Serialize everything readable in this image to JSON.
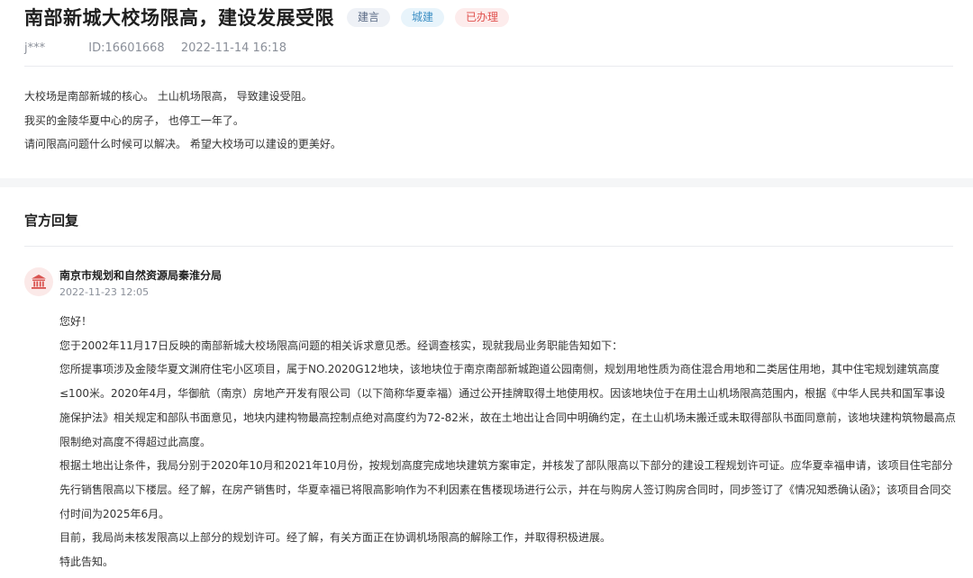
{
  "question": {
    "title": "南部新城大校场限高，建设发展受限",
    "tags": {
      "advice": "建言",
      "category": "城建",
      "status": "已办理"
    },
    "user": "j***",
    "id_label": "ID:16601668",
    "datetime": "2022-11-14 16:18",
    "body": [
      "大校场是南部新城的核心。 土山机场限高， 导致建设受阻。",
      "我买的金陵华夏中心的房子， 也停工一年了。",
      "请问限高问题什么时候可以解决。 希望大校场可以建设的更美好。"
    ]
  },
  "reply": {
    "section_title": "官方回复",
    "org_icon": "government-building-icon",
    "org_name": "南京市规划和自然资源局秦淮分局",
    "datetime": "2022-11-23 12:05",
    "paragraphs": [
      "您好！",
      "您于2002年11月17日反映的南部新城大校场限高问题的相关诉求意见悉。经调查核实，现就我局业务职能告知如下：",
      "您所提事项涉及金陵华夏文渊府住宅小区项目，属于NO.2020G12地块，该地块位于南京南部新城跑道公园南侧，规划用地性质为商住混合用地和二类居住用地，其中住宅规划建筑高度≤100米。2020年4月，华御航（南京）房地产开发有限公司（以下简称华夏幸福）通过公开挂牌取得土地使用权。因该地块位于在用土山机场限高范围内，根据《中华人民共和国军事设施保护法》相关规定和部队书面意见，地块内建构物最高控制点绝对高度约为72-82米，故在土地出让合同中明确约定，在土山机场未搬迁或未取得部队书面同意前，该地块建构筑物最高点限制绝对高度不得超过此高度。",
      "根据土地出让条件，我局分别于2020年10月和2021年10月份，按规划高度完成地块建筑方案审定，并核发了部队限高以下部分的建设工程规划许可证。应华夏幸福申请，该项目住宅部分先行销售限高以下楼层。经了解，在房产销售时，华夏幸福已将限高影响作为不利因素在售楼现场进行公示，并在与购房人签订购房合同时，同步签订了《情况知悉确认函》；该项目合同交付时间为2025年6月。",
      "目前，我局尚未核发限高以上部分的规划许可。经了解，有关方面正在协调机场限高的解除工作，并取得积极进展。",
      "特此告知。"
    ]
  },
  "colors": {
    "tag_advice": "#5a6a85",
    "tag_category": "#3d8fc4",
    "tag_status": "#e0504d",
    "avatar_icon": "#d9534f"
  }
}
